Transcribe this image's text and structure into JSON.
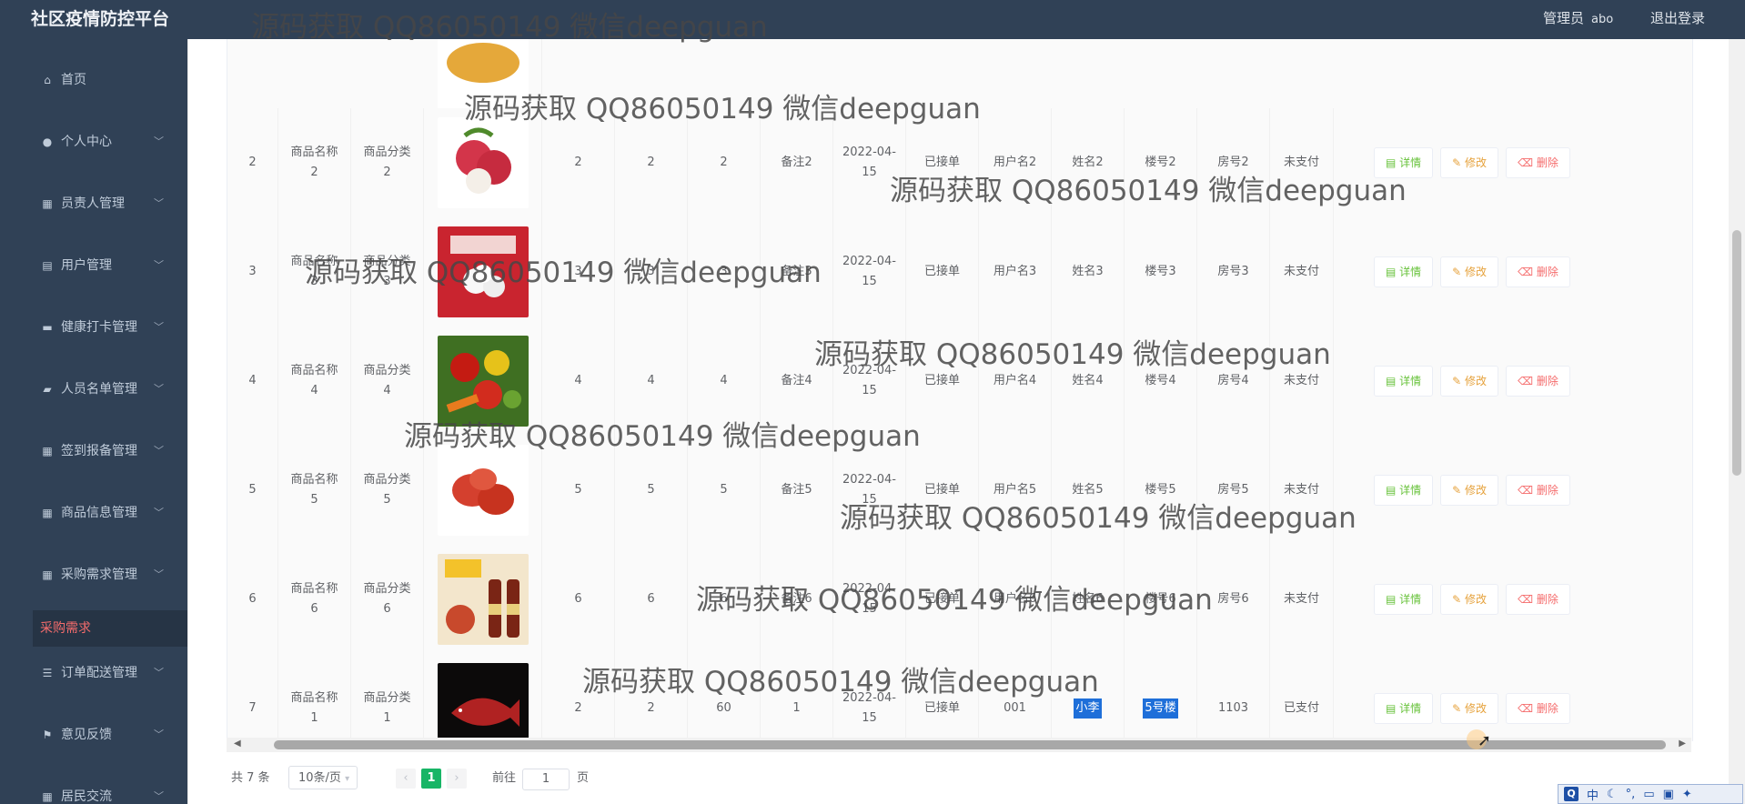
{
  "app": {
    "title": "社区疫情防控平台",
    "admin_label": "管理员",
    "admin_name": "abo",
    "logout_label": "退出登录"
  },
  "sidebar": {
    "items": [
      {
        "label": "首页",
        "icon": "home-icon",
        "glyph": "⌂",
        "expandable": false
      },
      {
        "label": "个人中心",
        "icon": "user-icon",
        "glyph": "●",
        "expandable": true
      },
      {
        "label": "员责人管理",
        "icon": "grid-icon",
        "glyph": "▦",
        "expandable": true
      },
      {
        "label": "用户管理",
        "icon": "document-icon",
        "glyph": "▤",
        "expandable": true
      },
      {
        "label": "健康打卡管理",
        "icon": "briefcase-icon",
        "glyph": "▬",
        "expandable": true
      },
      {
        "label": "人员名单管理",
        "icon": "chat-icon",
        "glyph": "▰",
        "expandable": true
      },
      {
        "label": "签到报备管理",
        "icon": "grid-icon",
        "glyph": "▦",
        "expandable": true
      },
      {
        "label": "商品信息管理",
        "icon": "grid-icon",
        "glyph": "▦",
        "expandable": true
      },
      {
        "label": "采购需求管理",
        "icon": "grid-icon",
        "glyph": "▦",
        "expandable": true
      },
      {
        "label": "订单配送管理",
        "icon": "list-icon",
        "glyph": "☰",
        "expandable": true
      },
      {
        "label": "意见反馈",
        "icon": "flag-icon",
        "glyph": "⚑",
        "expandable": true
      },
      {
        "label": "居民交流",
        "icon": "grid-icon",
        "glyph": "▦",
        "expandable": true
      }
    ],
    "active_sub": "采购需求"
  },
  "table": {
    "rows": [
      {
        "idx": "2",
        "name": [
          "商品名称",
          "2"
        ],
        "cat": [
          "商品分类",
          "2"
        ],
        "img": "lychee",
        "c1": "2",
        "c2": "2",
        "c3": "2",
        "note": "备注2",
        "date": [
          "2022-04-",
          "15"
        ],
        "status": "已接单",
        "user": "用户名2",
        "xm": "姓名2",
        "building": "楼号2",
        "room": "房号2",
        "pay": "未支付"
      },
      {
        "idx": "3",
        "name": [
          "商品名称",
          "3"
        ],
        "cat": [
          "商品分类",
          "3"
        ],
        "img": "dumpling-bag",
        "c1": "3",
        "c2": "3",
        "c3": "3",
        "note": "备注3",
        "date": [
          "2022-04-",
          "15"
        ],
        "status": "已接单",
        "user": "用户名3",
        "xm": "姓名3",
        "building": "楼号3",
        "room": "房号3",
        "pay": "未支付"
      },
      {
        "idx": "4",
        "name": [
          "商品名称",
          "4"
        ],
        "cat": [
          "商品分类",
          "4"
        ],
        "img": "vegetables",
        "c1": "4",
        "c2": "4",
        "c3": "4",
        "note": "备注4",
        "date": [
          "2022-04-",
          "15"
        ],
        "status": "已接单",
        "user": "用户名4",
        "xm": "姓名4",
        "building": "楼号4",
        "room": "房号4",
        "pay": "未支付"
      },
      {
        "idx": "5",
        "name": [
          "商品名称",
          "5"
        ],
        "cat": [
          "商品分类",
          "5"
        ],
        "img": "wax-apple",
        "c1": "5",
        "c2": "5",
        "c3": "5",
        "note": "备注5",
        "date": [
          "2022-04-",
          "15"
        ],
        "status": "已接单",
        "user": "用户名5",
        "xm": "姓名5",
        "building": "楼号5",
        "room": "房号5",
        "pay": "未支付"
      },
      {
        "idx": "6",
        "name": [
          "商品名称",
          "6"
        ],
        "cat": [
          "商品分类",
          "6"
        ],
        "img": "fish-sauce",
        "c1": "6",
        "c2": "6",
        "c3": "6",
        "note": "备注6",
        "date": [
          "2022-04-",
          "15"
        ],
        "status": "已接单",
        "user": "用户名6",
        "xm": "姓名6",
        "building": "楼号6",
        "room": "房号6",
        "pay": "未支付"
      },
      {
        "idx": "7",
        "name": [
          "商品名称",
          "1"
        ],
        "cat": [
          "商品分类",
          "1"
        ],
        "img": "arowana",
        "c1": "2",
        "c2": "2",
        "c3": "60",
        "note": "1",
        "date": [
          "2022-04-",
          "15"
        ],
        "status": "已接单",
        "user": "001",
        "xm": "小李",
        "building": "5号楼",
        "room": "1103",
        "pay": "已支付"
      }
    ],
    "actions": {
      "detail": "详情",
      "edit": "修改",
      "delete": "删除"
    }
  },
  "pagination": {
    "total": "共 7 条",
    "page_size": "10条/页",
    "current": "1",
    "goto_prefix": "前往",
    "goto_value": "1",
    "goto_suffix": "页"
  },
  "watermark": "源码获取 QQ86050149 微信deepguan",
  "ime": {
    "mode": "中"
  },
  "colors": {
    "sidebar": "#304156",
    "active": "#f56c6c",
    "detail": "#67c23a",
    "edit": "#e6a23c",
    "delete": "#f56c6c",
    "page_current": "#18b566"
  }
}
